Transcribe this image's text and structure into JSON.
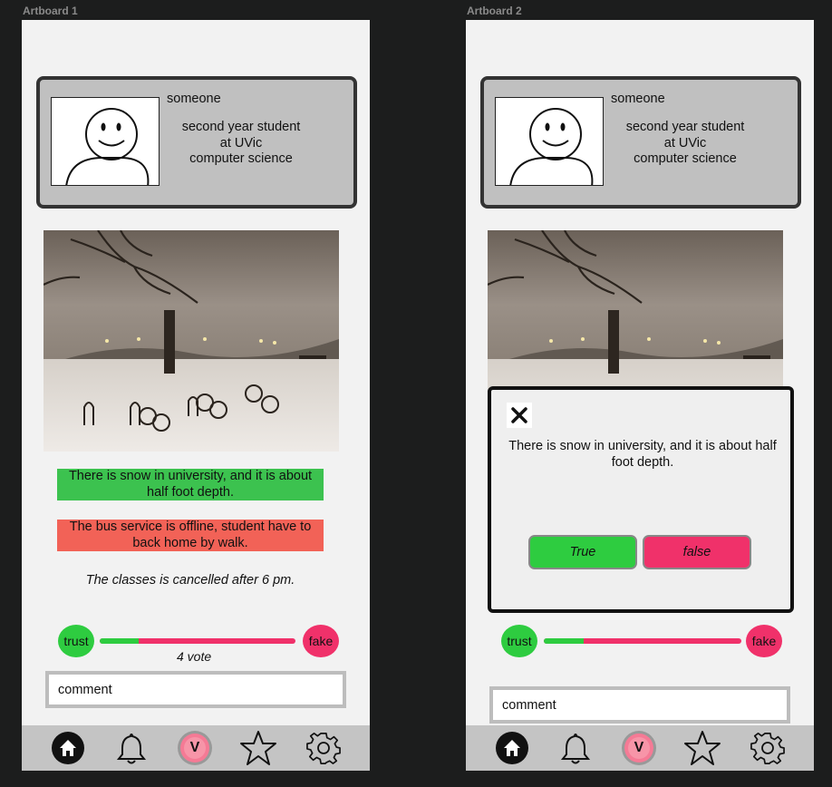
{
  "artboards": [
    {
      "label": "Artboard 1"
    },
    {
      "label": "Artboard 2"
    }
  ],
  "profile": {
    "name": "someone",
    "line1": "second year student",
    "line2": "at UVic",
    "line3": "computer science"
  },
  "claims": {
    "true_claim": "There is snow in university, and it is about half foot depth.",
    "false_claim": "The bus service is offline, student have to back home by walk.",
    "neutral_claim": "The classes is cancelled after 6 pm."
  },
  "vote": {
    "trust_label": "trust",
    "fake_label": "fake",
    "count_label": "4 vote",
    "trust_fraction_ab1": 0.2,
    "trust_fraction_ab2": 0.2
  },
  "comment": {
    "placeholder": "comment"
  },
  "modal": {
    "text": "There is snow in university, and it is about half foot depth.",
    "true_label": "True",
    "false_label": "false"
  },
  "nav": {
    "items": [
      {
        "icon": "home-icon"
      },
      {
        "icon": "bell-icon"
      },
      {
        "icon": "v-logo-icon",
        "label": "V"
      },
      {
        "icon": "star-icon"
      },
      {
        "icon": "gear-icon"
      }
    ]
  },
  "colors": {
    "trust_green": "#2ecc40",
    "fake_pink": "#f0316a",
    "claim_green": "#3cc24f",
    "claim_red": "#f26257"
  }
}
